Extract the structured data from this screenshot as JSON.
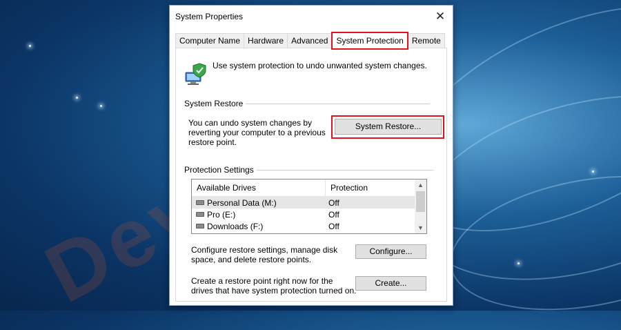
{
  "window": {
    "title": "System Properties",
    "close_glyph": "✕"
  },
  "tabs": [
    {
      "label": "Computer Name",
      "active": false
    },
    {
      "label": "Hardware",
      "active": false
    },
    {
      "label": "Advanced",
      "active": false
    },
    {
      "label": "System Protection",
      "active": true
    },
    {
      "label": "Remote",
      "active": false
    }
  ],
  "intro": {
    "icon": "system-protection-shield-icon",
    "text": "Use system protection to undo unwanted system changes."
  },
  "system_restore": {
    "section_title": "System Restore",
    "description": "You can undo system changes by reverting your computer to a previous restore point.",
    "button_label": "System Restore..."
  },
  "protection_settings": {
    "section_title": "Protection Settings",
    "columns": [
      "Available Drives",
      "Protection"
    ],
    "drives": [
      {
        "name": "Personal Data (M:)",
        "protection": "Off",
        "selected": true,
        "icon": "drive-icon"
      },
      {
        "name": "Pro (E:)",
        "protection": "Off",
        "selected": false,
        "icon": "drive-icon"
      },
      {
        "name": "Downloads (F:)",
        "protection": "Off",
        "selected": false,
        "icon": "drive-icon"
      }
    ],
    "configure_text": "Configure restore settings, manage disk space, and delete restore points.",
    "configure_button": "Configure...",
    "create_text": "Create a restore point right now for the drives that have system protection turned on.",
    "create_button": "Create..."
  },
  "colors": {
    "highlight": "#e0131c",
    "desktop": "#0b3566"
  },
  "watermark": "DevTricks"
}
